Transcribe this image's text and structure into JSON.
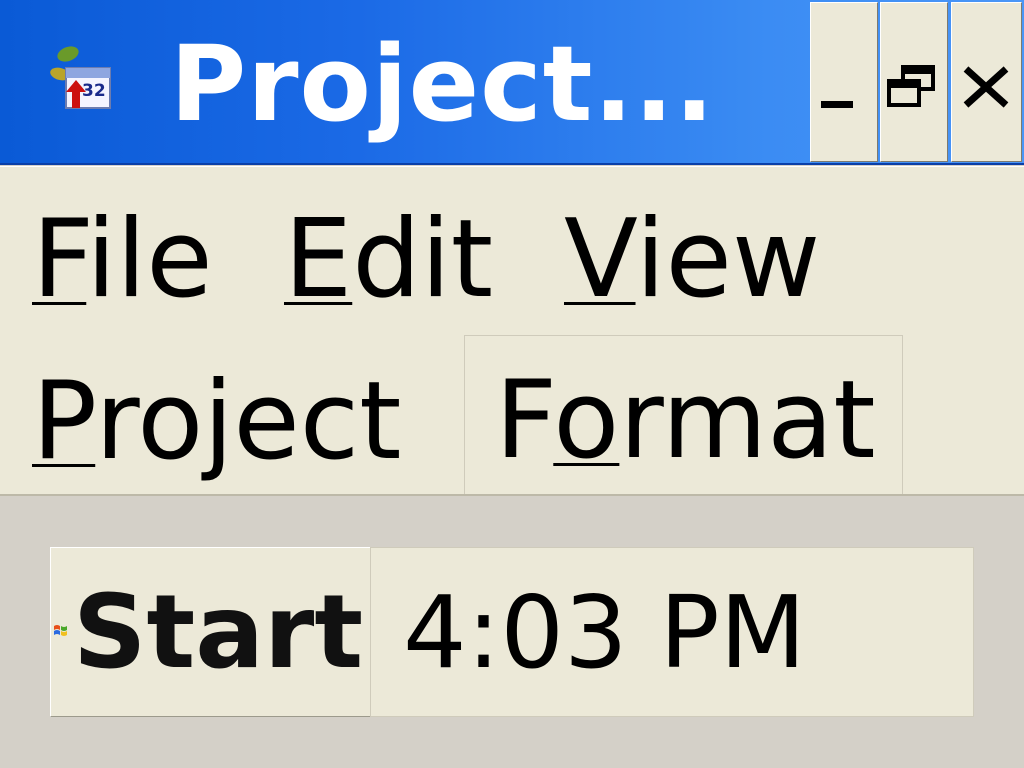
{
  "window": {
    "title": "Project...",
    "icon": "calendar-app-icon",
    "icon_badge": "32",
    "controls": {
      "minimize_icon": "minimize-icon",
      "restore_icon": "restore-icon",
      "close_icon": "close-icon"
    }
  },
  "menubar": {
    "items": [
      {
        "label_ul": "F",
        "label_rest": "ile"
      },
      {
        "label_ul": "E",
        "label_rest": "dit"
      },
      {
        "label_ul": "V",
        "label_rest": "iew"
      },
      {
        "label_ul": "P",
        "label_rest": "roject"
      },
      {
        "label_pre": "F",
        "label_ul": "o",
        "label_rest": "rmat"
      }
    ]
  },
  "taskbar": {
    "start_label": "Start",
    "start_icon": "windows-logo-icon",
    "clock": "4:03 PM"
  },
  "colors": {
    "titlebar_start": "#0a5ad6",
    "titlebar_end": "#4a96f7",
    "menu_bg": "#ece9d8",
    "desktop_bg": "#d4d0c8"
  }
}
